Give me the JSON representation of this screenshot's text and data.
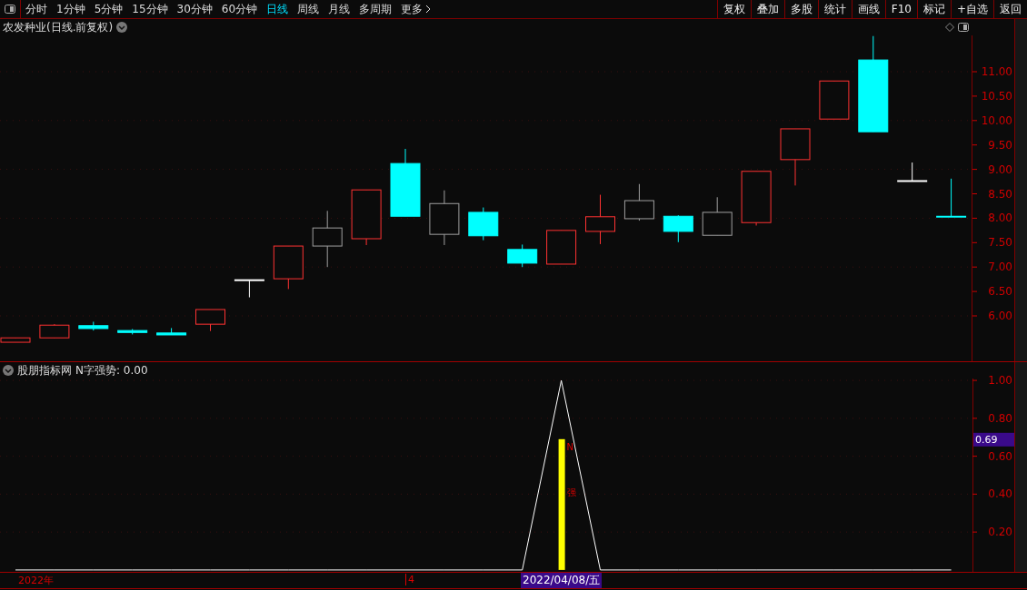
{
  "toolbar": {
    "periods": [
      {
        "label": "分时",
        "selected": false
      },
      {
        "label": "1分钟",
        "selected": false
      },
      {
        "label": "5分钟",
        "selected": false
      },
      {
        "label": "15分钟",
        "selected": false
      },
      {
        "label": "30分钟",
        "selected": false
      },
      {
        "label": "60分钟",
        "selected": false
      },
      {
        "label": "日线",
        "selected": true
      },
      {
        "label": "周线",
        "selected": false
      },
      {
        "label": "月线",
        "selected": false
      },
      {
        "label": "多周期",
        "selected": false
      },
      {
        "label": "更多",
        "selected": false
      }
    ],
    "buttons": [
      "复权",
      "叠加",
      "多股",
      "统计",
      "画线",
      "F10",
      "标记",
      "+自选",
      "返回"
    ]
  },
  "price_panel": {
    "title": "农发种业(日线.前复权)",
    "price_axis": [
      "11.00",
      "10.50",
      "10.00",
      "9.50",
      "9.00",
      "8.50",
      "8.00",
      "7.50",
      "7.00",
      "6.50",
      "6.00"
    ]
  },
  "indicator_panel": {
    "title": "股朋指标网",
    "reading": "N字强势: 0.00",
    "cursor_value": "0.69",
    "bar_labels": [
      "N",
      "强"
    ],
    "chart_data": {
      "type": "line",
      "grid": true,
      "ylim": [
        -0.01,
        1.01
      ],
      "yticks": [
        {
          "value": 0.2,
          "label": "0.20"
        },
        {
          "value": 0.4,
          "label": "0.40"
        },
        {
          "value": 0.6,
          "label": "0.60"
        },
        {
          "value": 0.8,
          "label": "0.80"
        },
        {
          "value": 1,
          "label": "1.00"
        }
      ],
      "series": [
        {
          "type": "line",
          "color": "#ffffff",
          "values": [
            0,
            0,
            0,
            0,
            0,
            0,
            0,
            0,
            0,
            0,
            0,
            0,
            0,
            0,
            1,
            0,
            0,
            0,
            0,
            0,
            0,
            0,
            0,
            0,
            0
          ]
        },
        {
          "type": "bar",
          "color": "#ffff00",
          "values": [
            null,
            null,
            null,
            null,
            null,
            null,
            null,
            null,
            null,
            null,
            null,
            null,
            null,
            null,
            0.69,
            null,
            null,
            null,
            null,
            null,
            null,
            null,
            null,
            null,
            null
          ]
        }
      ]
    }
  },
  "date_axis": {
    "year": "2022年",
    "month": "4",
    "cursor_date": "2022/04/08/五"
  }
}
